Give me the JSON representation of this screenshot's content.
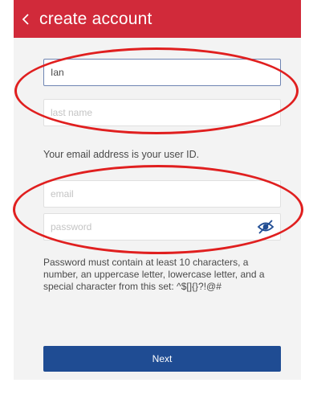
{
  "header": {
    "title": "create account",
    "back_icon": "chevron-left-icon",
    "color": "#d12a3a"
  },
  "form": {
    "first_name": {
      "value": "Ian",
      "placeholder": ""
    },
    "last_name": {
      "value": "",
      "placeholder": "last name"
    },
    "email_note": "Your email address is your user ID.",
    "email": {
      "value": "",
      "placeholder": "email"
    },
    "password": {
      "value": "",
      "placeholder": "password",
      "toggle_icon": "eye-slash-icon",
      "toggle_color": "#1f4c93"
    },
    "password_rules": "Password must contain at least 10 characters, a number, an uppercase letter, lowercase letter, and a special character from this set: ^$[]{}?!@#",
    "next_label": "Next",
    "next_color": "#1f4c93"
  },
  "annotations": {
    "circle_color": "#e01f1f"
  }
}
